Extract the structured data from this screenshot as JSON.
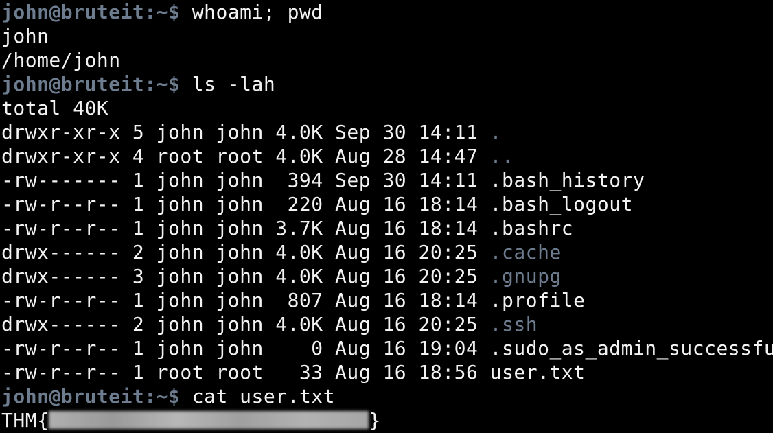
{
  "prompt": {
    "user_host": "john@bruteit",
    "path": ":~$ "
  },
  "colors": {
    "background": "#000000",
    "text": "#f2f2f2",
    "prompt": "#6d7c8f",
    "directory": "#6d7c8f"
  },
  "commands": {
    "c1": "whoami; pwd",
    "c2": "ls -lah",
    "c3": "cat user.txt"
  },
  "output1": [
    "john",
    "/home/john"
  ],
  "total": "total 40K",
  "listing": [
    {
      "meta": "drwxr-xr-x 5 john john 4.0K Sep 30 14:11 ",
      "name": ".",
      "is_dir": true
    },
    {
      "meta": "drwxr-xr-x 4 root root 4.0K Aug 28 14:47 ",
      "name": "..",
      "is_dir": true
    },
    {
      "meta": "-rw------- 1 john john  394 Sep 30 14:11 ",
      "name": ".bash_history",
      "is_dir": false
    },
    {
      "meta": "-rw-r--r-- 1 john john  220 Aug 16 18:14 ",
      "name": ".bash_logout",
      "is_dir": false
    },
    {
      "meta": "-rw-r--r-- 1 john john 3.7K Aug 16 18:14 ",
      "name": ".bashrc",
      "is_dir": false
    },
    {
      "meta": "drwx------ 2 john john 4.0K Aug 16 20:25 ",
      "name": ".cache",
      "is_dir": true
    },
    {
      "meta": "drwx------ 3 john john 4.0K Aug 16 20:25 ",
      "name": ".gnupg",
      "is_dir": true
    },
    {
      "meta": "-rw-r--r-- 1 john john  807 Aug 16 18:14 ",
      "name": ".profile",
      "is_dir": false
    },
    {
      "meta": "drwx------ 2 john john 4.0K Aug 16 20:25 ",
      "name": ".ssh",
      "is_dir": true
    },
    {
      "meta": "-rw-r--r-- 1 john john    0 Aug 16 19:04 ",
      "name": ".sudo_as_admin_successful",
      "is_dir": false
    },
    {
      "meta": "-rw-r--r-- 1 root root   33 Aug 16 18:56 ",
      "name": "user.txt",
      "is_dir": false
    }
  ],
  "flag": {
    "prefix": "THM{",
    "suffix": "}"
  }
}
